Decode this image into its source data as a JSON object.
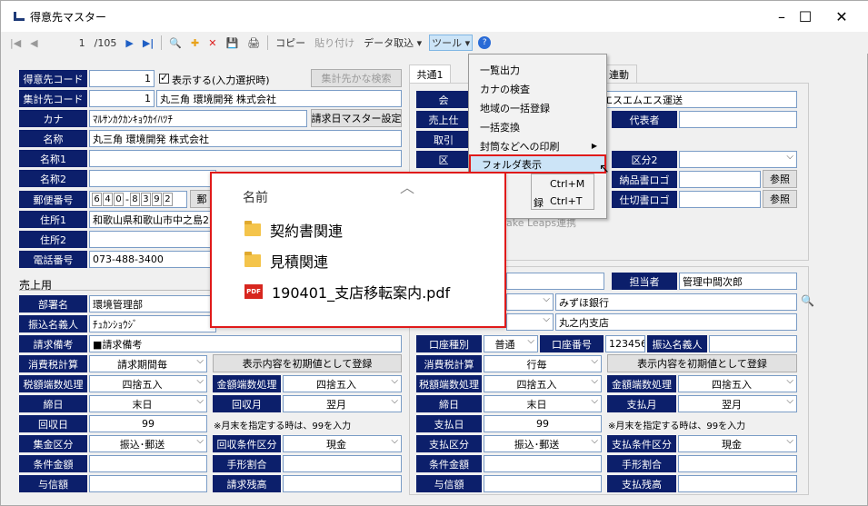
{
  "window": {
    "title": "得意先マスター",
    "min": "–",
    "max": "☐",
    "close": "✕"
  },
  "toolbar": {
    "first": "|◀",
    "prev": "◀",
    "record": "1",
    "count": "/105",
    "next": "▶",
    "last": "▶|",
    "find": "🔍",
    "add": "✚",
    "delete": "✕",
    "save": "💾",
    "print": "🖨",
    "copy": "コピー",
    "paste": "貼り付け",
    "import": "データ取込 ▾",
    "tools": "ツール ▾",
    "help": "?"
  },
  "left": {
    "code_label": "得意先コード",
    "code": "1",
    "show_check": "表示する(入力選択時)",
    "kana_search": "集計先かな検索",
    "group_label": "集計先コード",
    "group_code": "1",
    "group_name": "丸三角 環境開発 株式会社",
    "kana_label": "カナ",
    "kana": "ﾏﾙｻﾝｶｸｶﾝｷｮｳｶｲﾊﾂﾁ",
    "billing_btn": "請求日マスター設定",
    "name_label": "名称",
    "name": "丸三角 環境開発 株式会社",
    "name1_label": "名称1",
    "name2_label": "名称2",
    "zip_label": "郵便番号",
    "zip_digits": [
      "6",
      "4",
      "0",
      "8",
      "3",
      "9",
      "2"
    ],
    "zip_btn": "郵",
    "addr1_label": "住所1",
    "addr1": "和歌山県和歌山市中之島2",
    "addr2_label": "住所2",
    "tel_label": "電話番号",
    "tel": "073-488-3400",
    "sales_title": "売上用",
    "dept_label": "部署名",
    "dept": "環境管理部",
    "payer_label": "振込名義人",
    "payer": "ﾁｭｶﾝｼｮｳｼﾞ",
    "note_label": "請求備考",
    "note": "■請求備考",
    "tax_label": "消費税計算",
    "tax": "請求期間毎",
    "reset_btn": "表示内容を初期値として登録",
    "round_label": "税額端数処理",
    "round": "四捨五入",
    "amt_round_label": "金額端数処理",
    "amt_round": "四捨五入",
    "close_label": "締日",
    "close": "末日",
    "collect_month_label": "回収月",
    "collect_month": "翌月",
    "collect_day_label": "回収日",
    "collect_day": "99",
    "hint": "※月末を指定する時は、99を入力",
    "coll_type_label": "集金区分",
    "coll_type": "振込･郵送",
    "coll_cond_label": "回収条件区分",
    "coll_cond": "現金",
    "cond_amt_label": "条件金額",
    "bill_ratio_label": "手形割合",
    "credit_label": "与信額",
    "bill_balance_label": "請求残高"
  },
  "right": {
    "tab1": "共通1",
    "tab2": "連動",
    "company_label": "会",
    "company_value": "エスエムエス運送",
    "rep_label": "代表者",
    "sales_label": "売上仕",
    "dealer_label": "取引",
    "region_label": "区",
    "class2_label": "区分2",
    "delivery_logo_label": "納品書ロゴ",
    "ref_btn": "参照",
    "slip_logo_label": "仕切書ロゴ",
    "ref_btn2": "参照",
    "leaps": "ake Leaps連携",
    "staff_label": "担当者",
    "staff": "管理中間次郎",
    "bank": "みずほ銀行",
    "branch": "丸之内支店",
    "acct_type_label": "口座種別",
    "acct_type": "普通",
    "acct_no_label": "口座番号",
    "acct_no": "123456",
    "acct_name_label": "振込名義人",
    "tax_label": "消費税計算",
    "tax": "行毎",
    "reset_btn": "表示内容を初期値として登録",
    "round_label": "税額端数処理",
    "round": "四捨五入",
    "amt_round_label": "金額端数処理",
    "amt_round": "四捨五入",
    "close_label": "締日",
    "close": "末日",
    "pay_month_label": "支払月",
    "pay_month": "翌月",
    "pay_day_label": "支払日",
    "pay_day": "99",
    "hint": "※月末を指定する時は、99を入力",
    "pay_type_label": "支払区分",
    "pay_type": "振込･郵送",
    "pay_cond_label": "支払条件区分",
    "pay_cond": "現金",
    "cond_amt_label": "条件金額",
    "bill_ratio_label": "手形割合",
    "credit_label": "与信額",
    "pay_balance_label": "支払残高"
  },
  "menu": {
    "items": [
      "一覧出力",
      "カナの検査",
      "地域の一括登録",
      "一括変換",
      "封筒などへの印刷",
      "フォルダ表示"
    ],
    "sub": [
      "Ctrl+M",
      "Ctrl+T"
    ],
    "sub_prefix": "録"
  },
  "popup": {
    "header": "名前",
    "items": [
      "契約書関連",
      "見積関連",
      "190401_支店移転案内.pdf"
    ],
    "pdf_badge": "PDF"
  }
}
